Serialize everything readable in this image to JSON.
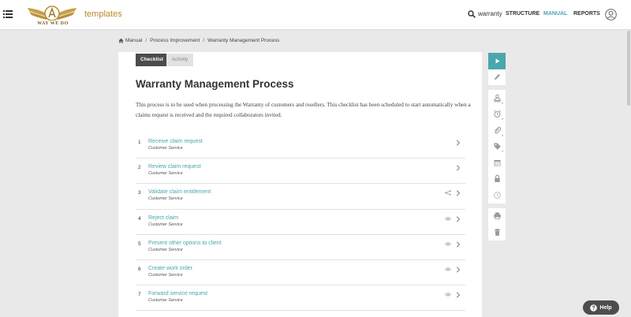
{
  "header": {
    "logo_text": "WAY WE DO",
    "brand": "templates",
    "search_text": "warranty",
    "nav": [
      {
        "label": "STRUCTURE",
        "active": false
      },
      {
        "label": "MANUAL",
        "active": true
      },
      {
        "label": "REPORTS",
        "active": false
      }
    ]
  },
  "breadcrumb": [
    "Manual",
    "Process Improvement",
    "Warranty Management Process"
  ],
  "tabs": [
    "Checklist",
    "Activity"
  ],
  "title": "Warranty Management Process",
  "description": "This process is to be used when processing the Warranty of customers and resellers. This checklist has been scheduled to start automatically when a claims request is received and the required collaborators invited.",
  "steps": [
    {
      "num": "1",
      "name": "Receive claim request",
      "role": "Customer Service",
      "status_icon": ""
    },
    {
      "num": "2",
      "name": "Review claim request",
      "role": "Customer Service",
      "status_icon": ""
    },
    {
      "num": "3",
      "name": "Validate claim entitlement",
      "role": "Customer Service",
      "status_icon": "share-icon"
    },
    {
      "num": "4",
      "name": "Reject claim",
      "role": "Customer Service",
      "status_icon": "eye-icon"
    },
    {
      "num": "5",
      "name": "Present other options to client",
      "role": "Customer Service",
      "status_icon": "eye-icon"
    },
    {
      "num": "6",
      "name": "Create work order",
      "role": "Customer Service",
      "status_icon": "eye-icon"
    },
    {
      "num": "7",
      "name": "Forward service request",
      "role": "Customer Service",
      "status_icon": "eye-icon"
    }
  ],
  "toolbar_counts": {
    "users": "0",
    "bell": "0",
    "attach": "0",
    "tag": "0"
  },
  "help_label": "Help",
  "colors": {
    "accent": "#4aa6ad",
    "brand": "#b88a2a",
    "dark": "#4b4b4b"
  }
}
